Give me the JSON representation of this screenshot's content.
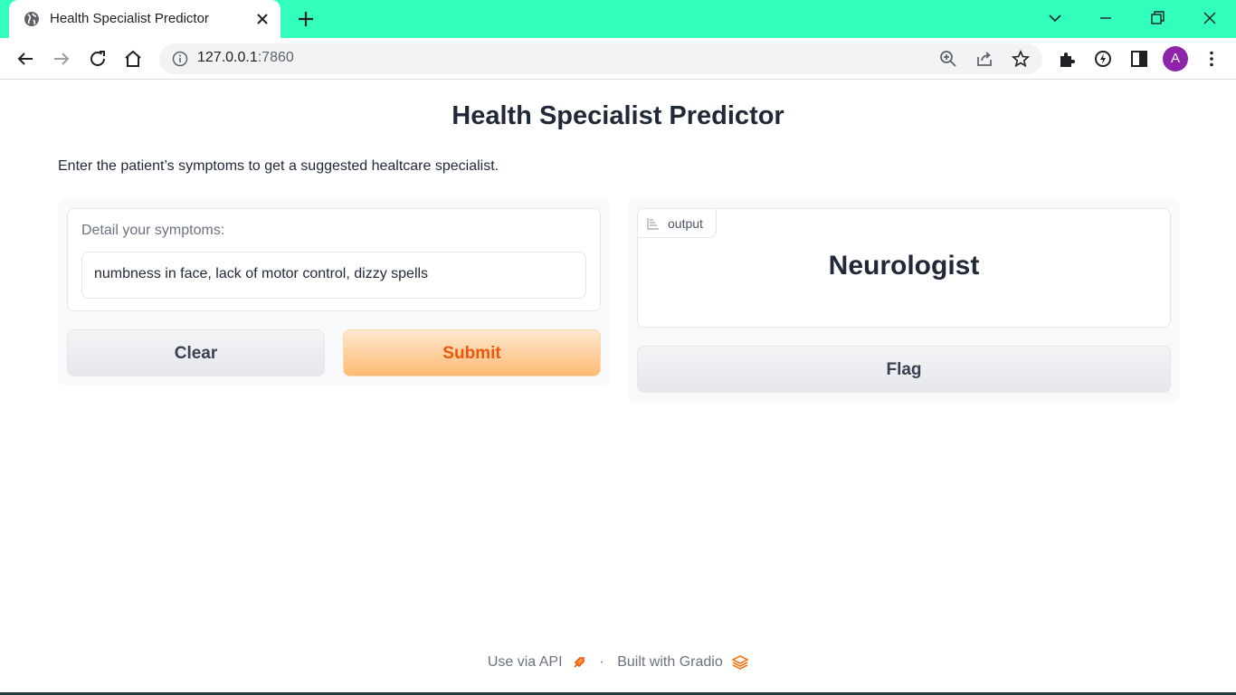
{
  "browser": {
    "tab_title": "Health Specialist Predictor",
    "url_host": "127.0.0.1",
    "url_port": ":7860",
    "avatar_letter": "A",
    "accent_color": "#33ffbc",
    "icons": [
      "globe-icon",
      "close-icon",
      "plus-icon",
      "chevron-down-icon",
      "minimize-icon",
      "restore-icon",
      "window-close-icon",
      "back-icon",
      "forward-icon",
      "reload-icon",
      "home-icon",
      "info-icon",
      "zoom-icon",
      "share-icon",
      "star-icon",
      "extensions-icon",
      "performance-icon",
      "side-panel-icon",
      "menu-icon"
    ]
  },
  "app": {
    "title": "Health Specialist Predictor",
    "description": "Enter the patient’s symptoms to get a suggested healtcare specialist.",
    "input": {
      "label": "Detail your symptoms:",
      "value": "numbness in face, lack of motor control, dizzy spells"
    },
    "buttons": {
      "clear": "Clear",
      "submit": "Submit",
      "flag": "Flag"
    },
    "output": {
      "label": "output",
      "value": "Neurologist"
    },
    "footer": {
      "api": "Use via API",
      "separator": "·",
      "built": "Built with Gradio"
    },
    "colors": {
      "primary_text": "#ea580c",
      "primary_bg": "#fdba74"
    }
  }
}
